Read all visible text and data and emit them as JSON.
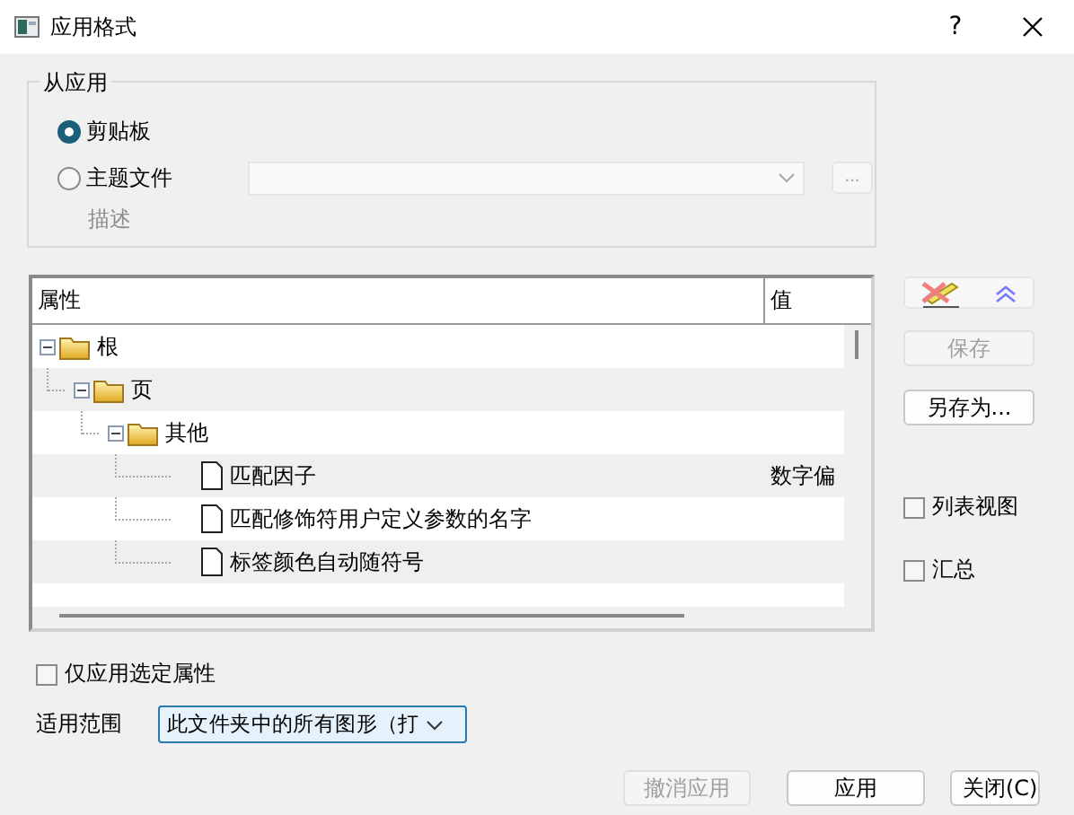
{
  "window": {
    "title": "应用格式",
    "help": "?"
  },
  "source_group": {
    "title": "从应用",
    "options": [
      {
        "label": "剪贴板",
        "selected": true
      },
      {
        "label": "主题文件",
        "selected": false
      }
    ],
    "theme_file_dropdown": {
      "disabled": true
    },
    "browse_button": "...",
    "description_label": "描述"
  },
  "tree": {
    "columns": [
      "属性",
      "值"
    ],
    "items": [
      {
        "label": "根",
        "kind": "folder",
        "expanded": true,
        "children": [
          {
            "label": "页",
            "kind": "folder",
            "expanded": true,
            "children": [
              {
                "label": "其他",
                "kind": "folder",
                "expanded": true,
                "children": [
                  {
                    "label": "匹配因子",
                    "kind": "leaf",
                    "value": "数字偏"
                  },
                  {
                    "label": "匹配修饰符用户定义参数的名字",
                    "kind": "leaf"
                  },
                  {
                    "label": "标签颜色自动随符号",
                    "kind": "leaf"
                  }
                ]
              }
            ]
          }
        ]
      }
    ]
  },
  "side": {
    "buttons": [
      {
        "label": "保存",
        "disabled": true
      },
      {
        "label": "另存为...",
        "disabled": false
      }
    ],
    "checkboxes": [
      {
        "label": "列表视图",
        "checked": false
      },
      {
        "label": "汇总",
        "checked": false
      }
    ]
  },
  "apply_selected_only": {
    "label": "仅应用选定属性",
    "checked": false
  },
  "scope": {
    "label": "适用范围",
    "value": "此文件夹中的所有图形（打"
  },
  "buttons": [
    {
      "label": "撤消应用",
      "disabled": true
    },
    {
      "label": "应用",
      "disabled": false
    },
    {
      "label": "关闭(C)",
      "disabled": false
    }
  ]
}
